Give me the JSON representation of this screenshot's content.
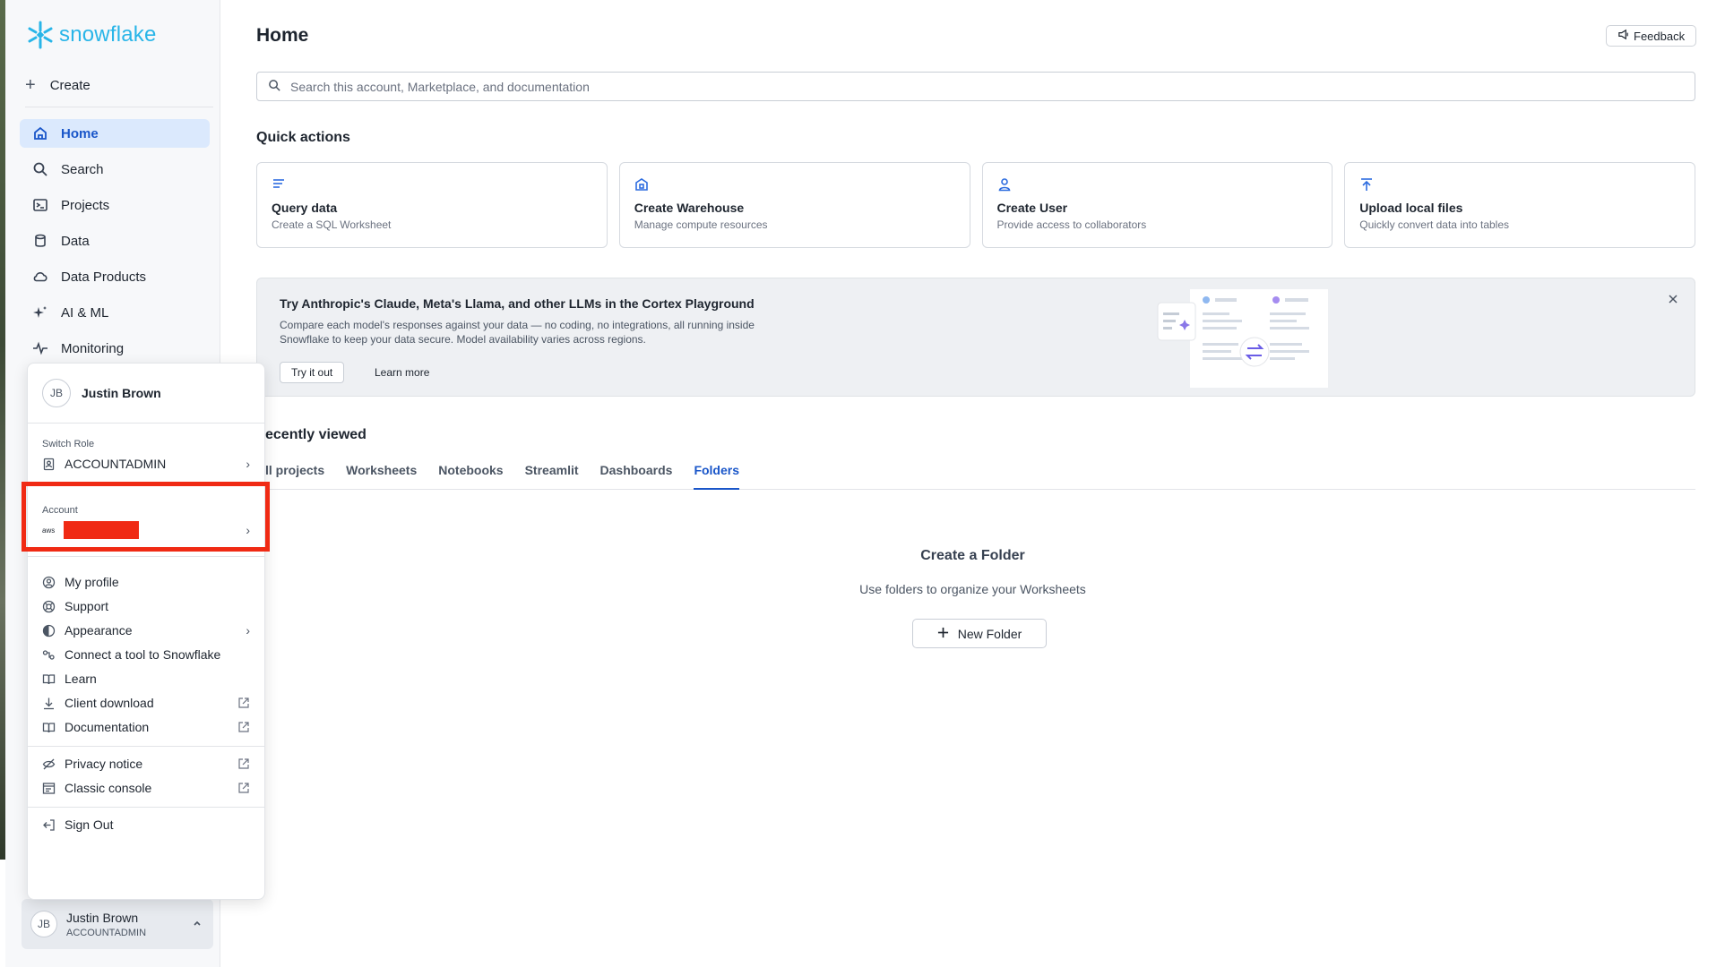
{
  "app": {
    "logo_text": "snowflake",
    "brand_color": "#29b5e8",
    "accent_color": "#1a56c9"
  },
  "sidebar": {
    "create_label": "Create",
    "items": [
      {
        "label": "Home",
        "icon": "home-icon",
        "active": true
      },
      {
        "label": "Search",
        "icon": "search-icon"
      },
      {
        "label": "Projects",
        "icon": "terminal-icon"
      },
      {
        "label": "Data",
        "icon": "database-icon"
      },
      {
        "label": "Data Products",
        "icon": "cloud-icon"
      },
      {
        "label": "AI & ML",
        "icon": "sparkle-icon"
      },
      {
        "label": "Monitoring",
        "icon": "activity-icon"
      }
    ]
  },
  "header": {
    "title": "Home",
    "feedback_label": "Feedback"
  },
  "search": {
    "placeholder": "Search this account, Marketplace, and documentation"
  },
  "quick_actions": {
    "title": "Quick actions",
    "cards": [
      {
        "title": "Query data",
        "subtitle": "Create a SQL Worksheet",
        "icon": "lines-icon"
      },
      {
        "title": "Create Warehouse",
        "subtitle": "Manage compute resources",
        "icon": "warehouse-icon"
      },
      {
        "title": "Create User",
        "subtitle": "Provide access to collaborators",
        "icon": "user-icon"
      },
      {
        "title": "Upload local files",
        "subtitle": "Quickly convert data into tables",
        "icon": "upload-icon"
      }
    ]
  },
  "banner": {
    "title": "Try Anthropic's Claude, Meta's Llama, and other LLMs in the Cortex Playground",
    "desc_line1": "Compare each model's responses against your data — no coding, no integrations, all running inside",
    "desc_line2": "Snowflake to keep your data secure. Model availability varies across regions.",
    "try_label": "Try it out",
    "learn_label": "Learn more"
  },
  "recent": {
    "title": "ecently viewed",
    "tabs": [
      "ll projects",
      "Worksheets",
      "Notebooks",
      "Streamlit",
      "Dashboards",
      "Folders"
    ],
    "active_tab": "Folders"
  },
  "empty_state": {
    "title": "Create a Folder",
    "subtitle": "Use folders to organize your Worksheets",
    "button_label": "New Folder"
  },
  "user_menu": {
    "initials": "JB",
    "name": "Justin Brown",
    "switch_role_label": "Switch Role",
    "role": "ACCOUNTADMIN",
    "account_label": "Account",
    "aws_label": "aws",
    "items": [
      {
        "label": "My profile",
        "icon": "profile-icon"
      },
      {
        "label": "Support",
        "icon": "lifebuoy-icon"
      },
      {
        "label": "Appearance",
        "icon": "contrast-icon"
      },
      {
        "label": "Connect a tool to Snowflake",
        "icon": "link-icon"
      },
      {
        "label": "Learn",
        "icon": "book-icon"
      },
      {
        "label": "Client download",
        "icon": "download-icon"
      },
      {
        "label": "Documentation",
        "icon": "book-icon"
      },
      {
        "label": "Privacy notice",
        "icon": "eye-off-icon"
      },
      {
        "label": "Classic console",
        "icon": "console-icon"
      },
      {
        "label": "Sign Out",
        "icon": "sign-out-icon"
      }
    ]
  },
  "footer_user": {
    "initials": "JB",
    "name": "Justin Brown",
    "role": "ACCOUNTADMIN"
  }
}
